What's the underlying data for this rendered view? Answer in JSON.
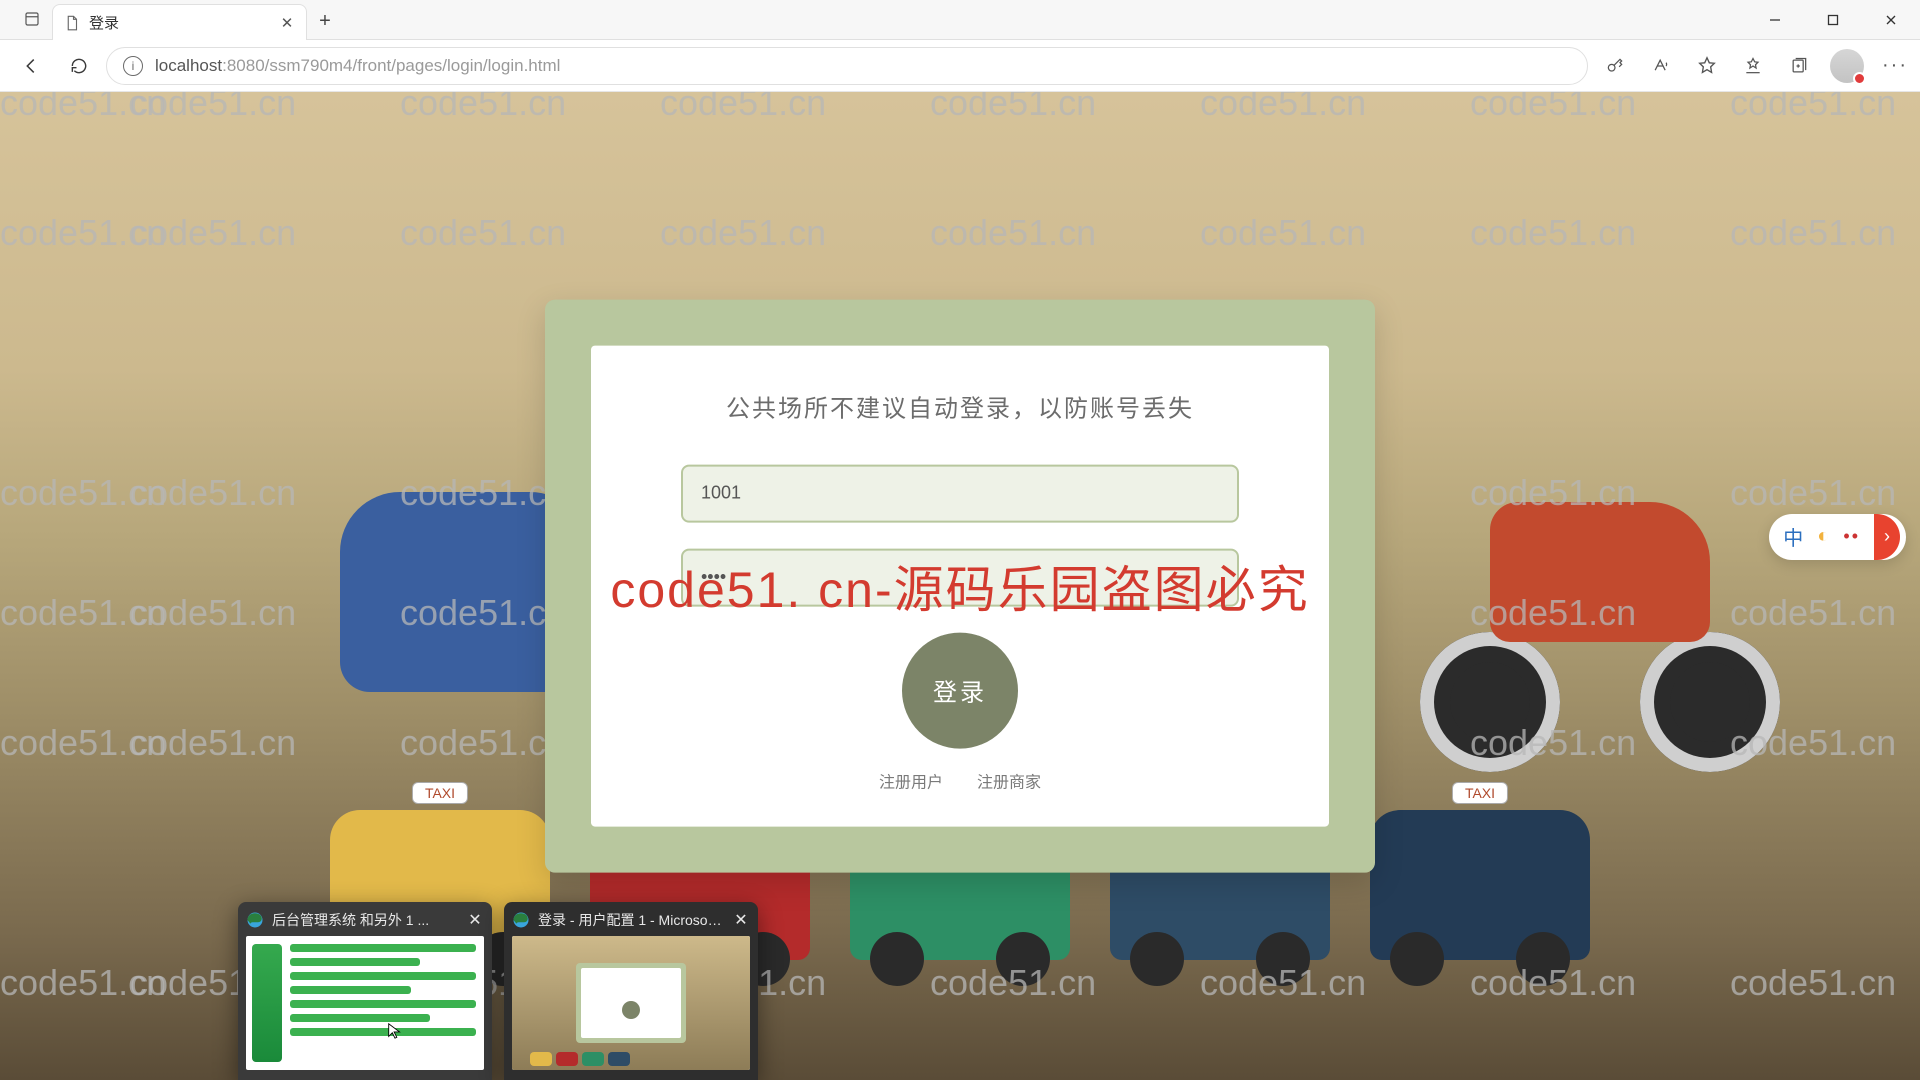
{
  "browser": {
    "tab_title": "登录",
    "url_host": "localhost",
    "url_port_path": ":8080/ssm790m4/front/pages/login/login.html"
  },
  "watermark": {
    "text": "code51.cn"
  },
  "big_watermark": "code51. cn-源码乐园盗图必究",
  "login": {
    "notice": "公共场所不建议自动登录，以防账号丢失",
    "username_value": "1001",
    "password_mask": "••••",
    "submit_label": "登录",
    "register_user": "注册用户",
    "register_merchant": "注册商家"
  },
  "ime": {
    "mode": "中"
  },
  "taxi_sign": "TAXI",
  "task_previews": {
    "a_title": "后台管理系统 和另外 1 ...",
    "b_title": "登录 - 用户配置 1 - Microsoft..."
  }
}
